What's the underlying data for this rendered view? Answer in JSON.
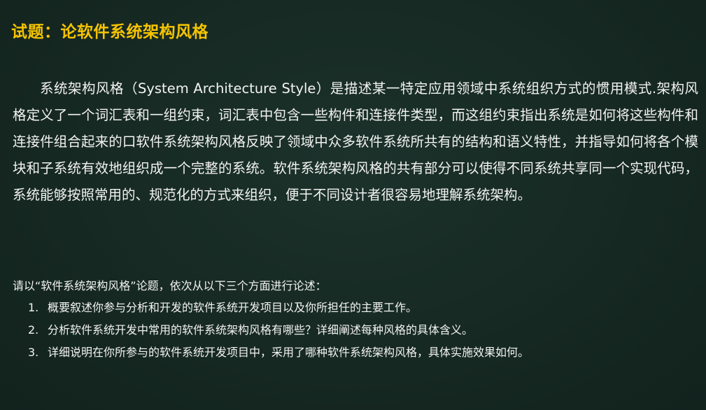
{
  "title": "试题：论软件系统架构风格",
  "paragraph": "系统架构风格（System Architecture Style）是描述某一特定应用领域中系统组织方式的惯用模式.架构风格定义了一个词汇表和一组约束，词汇表中包含一些构件和连接件类型，而这组约束指出系统是如何将这些构件和连接件组合起来的口软件系统架构风格反映了领域中众多软件系统所共有的结构和语义特性，并指导如何将各个模块和子系统有效地组织成一个完整的系统。软件系统架构风格的共有部分可以使得不同系统共享同一个实现代码，系统能够按照常用的、规范化的方式来组织，便于不同设计者很容易地理解系统架构。",
  "prompt": "请以“软件系统架构风格”论题，依次从以下三个方面进行论述：",
  "questions": [
    {
      "num": "1.",
      "text": "概要叙述你参与分析和开发的软件系统开发项目以及你所担任的主要工作。"
    },
    {
      "num": "2.",
      "text": "分析软件系统开发中常用的软件系统架构风格有哪些？详细阐述每种风格的具体含义。"
    },
    {
      "num": "3.",
      "text": "详细说明在你所参与的软件系统开发项目中，采用了哪种软件系统架构风格，具体实施效果如何。"
    }
  ],
  "colors": {
    "background": "#172a24",
    "title": "#f5c400",
    "text": "#f3f3f3"
  }
}
